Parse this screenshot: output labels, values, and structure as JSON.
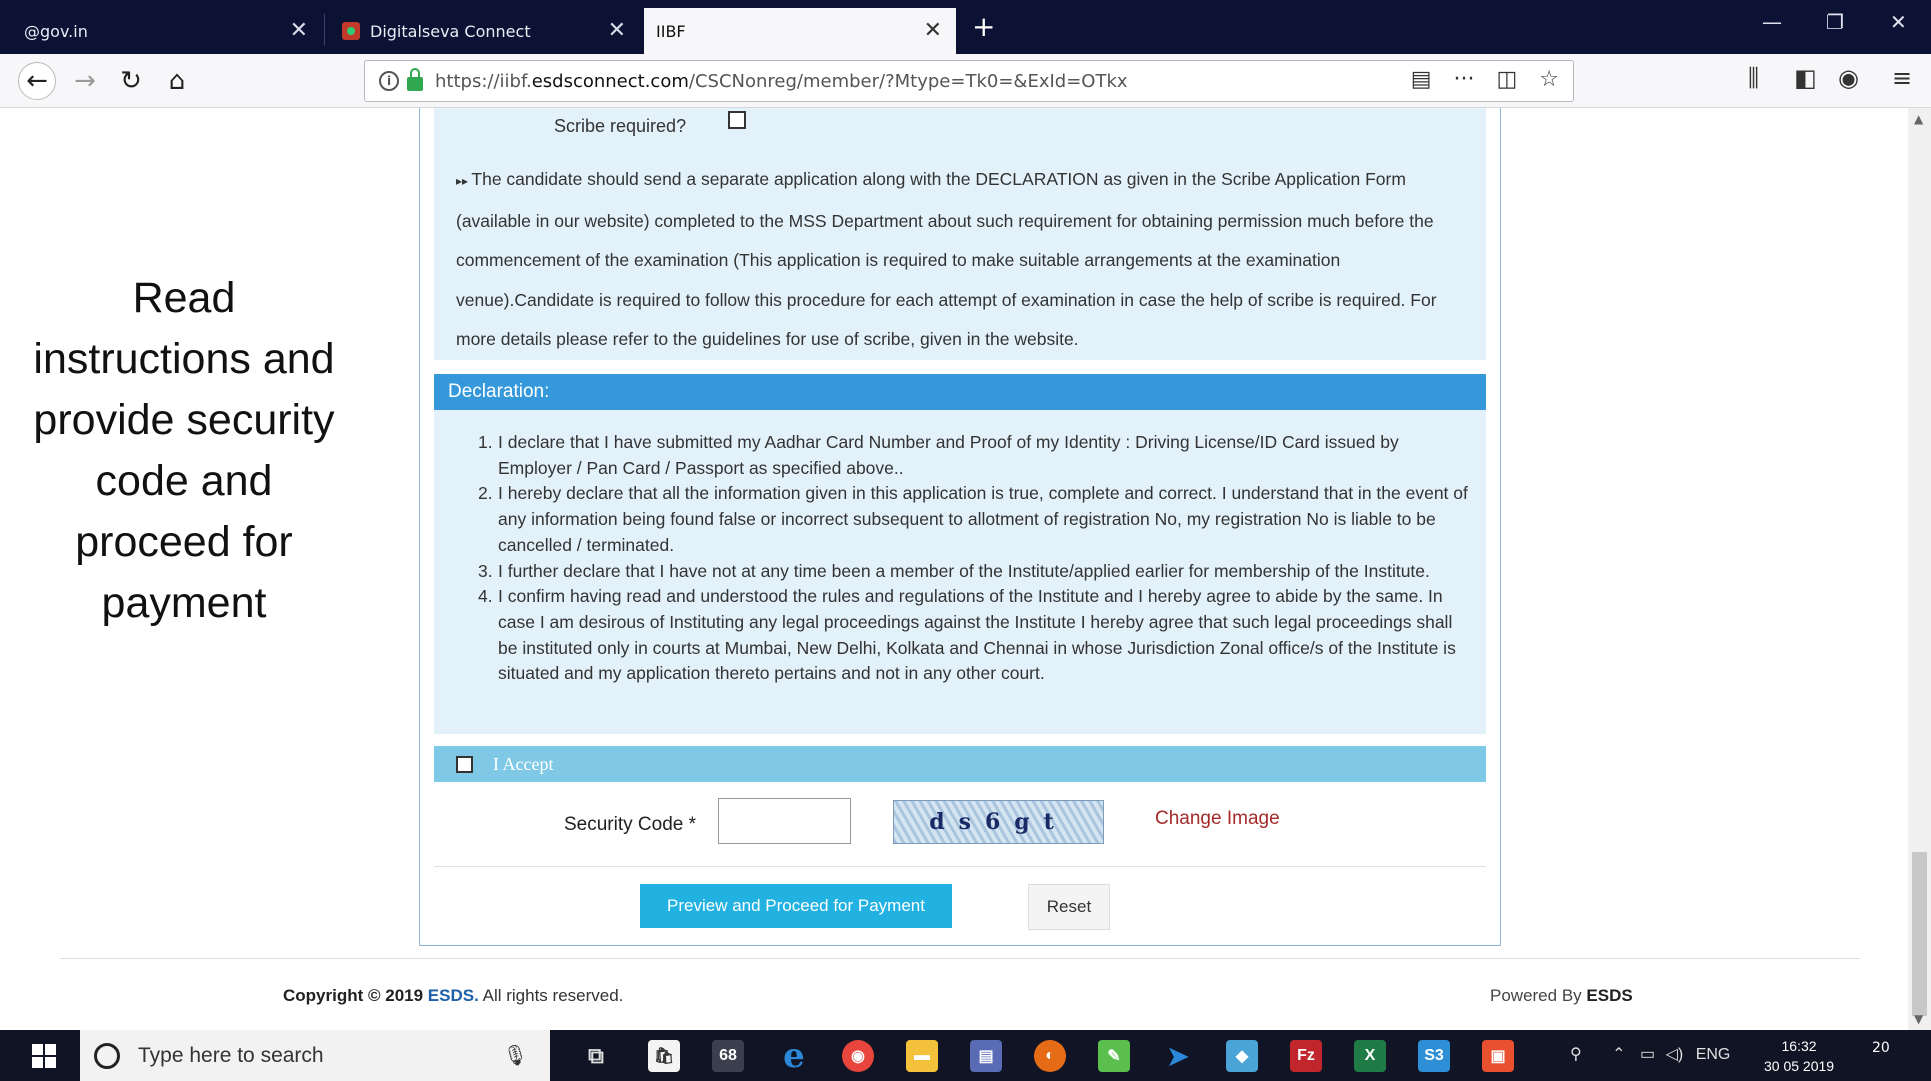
{
  "browser": {
    "tabs": [
      {
        "label": "@gov.in"
      },
      {
        "label": "Digitalseva Connect"
      },
      {
        "label": "IIBF"
      }
    ],
    "url_prefix": "https://iibf.",
    "url_domain": "esdsconnect.com",
    "url_path": "/CSCNonreg/member/?Mtype=Tk0=&ExId=OTkx",
    "icons": [
      "back-icon",
      "forward-icon",
      "reload-icon",
      "home-icon",
      "info-icon",
      "lock-icon",
      "reader-icon",
      "more-icon",
      "pocket-icon",
      "bookmark-star-icon",
      "library-icon",
      "sidebar-icon",
      "account-icon",
      "menu-icon"
    ]
  },
  "sidebar": {
    "instruction": "Read instructions and provide security code and proceed for payment"
  },
  "form": {
    "scribe_label": "Scribe required?",
    "scribe_note": "The candidate should send a separate application along with the DECLARATION as given in the Scribe Application Form (available in our website) completed to the MSS Department about such requirement for obtaining permission much before the commencement of the examination (This application is required to make suitable arrangements at the examination venue).Candidate is required to follow this procedure for each attempt of examination in case the help of scribe is required. For more details please refer to the guidelines for use of scribe, given in the website.",
    "declaration_title": "Declaration:",
    "declarations": [
      {
        "num": "1.",
        "text": "I declare that I have submitted my Aadhar Card Number and Proof of my Identity : Driving License/ID Card issued by Employer / Pan Card / Passport as specified above.."
      },
      {
        "num": "2.",
        "text": "I hereby declare that all the information given in this application is true, complete and correct. I understand that in the event of any information being found false or incorrect subsequent to allotment of registration No, my registration No is liable to be cancelled / terminated."
      },
      {
        "num": "3.",
        "text": "I further declare that I have not at any time been a member of the Institute/applied earlier for membership of the Institute."
      },
      {
        "num": "4.",
        "text": "I confirm having read and understood the rules and regulations of the Institute and I hereby agree to abide by the same. In case I am desirous of Instituting any legal proceedings against the Institute I hereby agree that such legal proceedings shall be instituted only in courts at Mumbai, New Delhi, Kolkata and Chennai in whose Jurisdiction Zonal office/s of the Institute is situated and my application thereto pertains and not in any other court."
      }
    ],
    "accept_label": "I Accept",
    "security_label": "Security Code *",
    "security_value": "",
    "captcha_text": "ds6gt",
    "change_image": "Change Image",
    "preview_button": "Preview and Proceed for Payment",
    "reset_button": "Reset"
  },
  "footer": {
    "copyright_prefix": "Copyright © 2019",
    "copyright_brand": "ESDS.",
    "copyright_suffix": "All rights reserved.",
    "powered_prefix": "Powered By",
    "powered_brand": "ESDS"
  },
  "taskbar": {
    "search_placeholder": "Type here to search",
    "lang": "ENG",
    "time": "16:32",
    "date": "30 05 2019",
    "notification_count": "20"
  }
}
